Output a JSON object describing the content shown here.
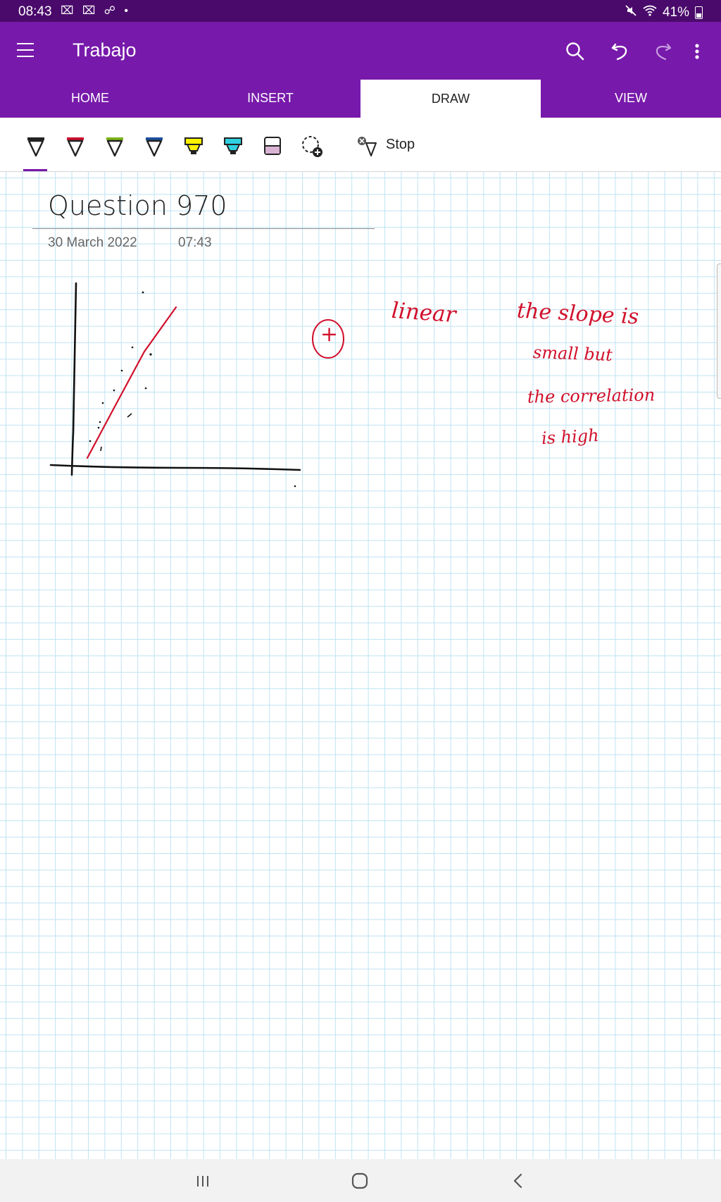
{
  "status_bar": {
    "time": "08:43",
    "notifications": "⌧ ⌧ ☍ •",
    "battery": "41%",
    "bg_color": "#4a0a6b"
  },
  "app_bar": {
    "notebook_title": "Trabajo",
    "color": "#7719aa",
    "icons": [
      "menu-icon",
      "search-icon",
      "undo-icon",
      "redo-icon",
      "more-icon"
    ]
  },
  "tabs": [
    {
      "label": "HOME",
      "active": false
    },
    {
      "label": "INSERT",
      "active": false
    },
    {
      "label": "DRAW",
      "active": true
    },
    {
      "label": "VIEW",
      "active": false
    }
  ],
  "draw_toolbar": {
    "tools": [
      "black-pen",
      "red-pen",
      "green-pen",
      "blue-pen",
      "yellow-highlighter",
      "cyan-highlighter",
      "pink-highlighter",
      "add-pen"
    ],
    "stop_label": "Stop"
  },
  "page": {
    "title": "Question 970",
    "date": "30 March 2022",
    "time": "07:43"
  },
  "handwriting": {
    "plus_symbol": "+",
    "word_linear": "linear",
    "line1": "the slope is",
    "line2": "small but",
    "line3": "the correlation",
    "line4": "is high",
    "ink_color": "#d1102b"
  },
  "nav_bar": {
    "buttons": [
      "recents-button",
      "home-button",
      "back-button"
    ]
  }
}
